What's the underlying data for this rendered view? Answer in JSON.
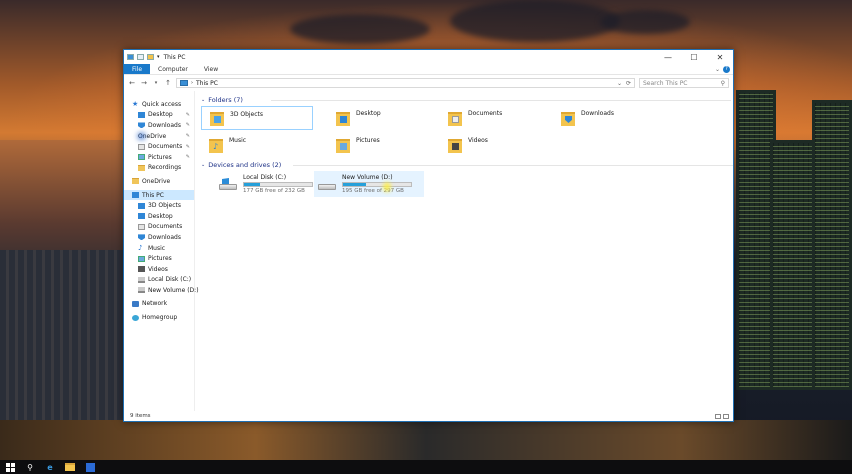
{
  "window": {
    "title": "This PC"
  },
  "ribbon": {
    "tabs": [
      "File",
      "Computer",
      "View"
    ],
    "help": "?"
  },
  "address": {
    "path": "This PC",
    "search_placeholder": "Search This PC"
  },
  "nav": {
    "quick_access": "Quick access",
    "quick_items": [
      "Desktop",
      "Downloads",
      "OneDrive",
      "Documents",
      "Pictures",
      "Recordings"
    ],
    "onedrive": "OneDrive",
    "this_pc": "This PC",
    "pc_items": [
      "3D Objects",
      "Desktop",
      "Documents",
      "Downloads",
      "Music",
      "Pictures",
      "Videos",
      "Local Disk (C:)",
      "New Volume (D:)"
    ],
    "network": "Network",
    "homegroup": "Homegroup"
  },
  "folders": {
    "heading": "Folders (7)",
    "items": [
      "3D Objects",
      "Desktop",
      "Documents",
      "Downloads",
      "Music",
      "Pictures",
      "Videos"
    ]
  },
  "drives": {
    "heading": "Devices and drives (2)",
    "items": [
      {
        "name": "Local Disk (C:)",
        "free": "177 GB free of 232 GB",
        "used_fraction": 0.24
      },
      {
        "name": "New Volume (D:)",
        "free": "195 GB free of 297 GB",
        "used_fraction": 0.34
      }
    ]
  },
  "status": {
    "count": "9 items"
  },
  "colors": {
    "accent": "#1979ca",
    "selection": "#cce8ff",
    "drive_bar": "#26a0da"
  }
}
